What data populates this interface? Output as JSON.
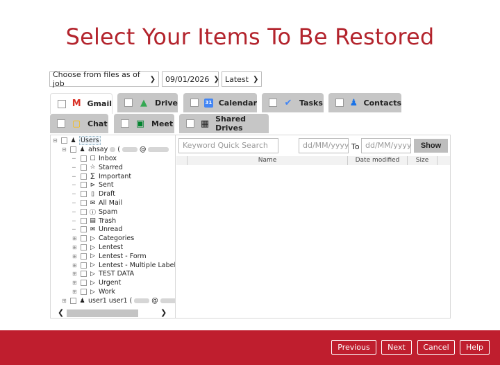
{
  "title": "Select Your Items To Be Restored",
  "filters": {
    "mode": "Choose from files as of job",
    "date": "09/01/2026",
    "version": "Latest"
  },
  "tabs": [
    {
      "label": "Gmail",
      "icon": "gmail-icon",
      "active": true
    },
    {
      "label": "Drive",
      "icon": "drive-icon"
    },
    {
      "label": "Calendar",
      "icon": "calendar-icon"
    },
    {
      "label": "Tasks",
      "icon": "tasks-icon"
    },
    {
      "label": "Contacts",
      "icon": "contacts-icon"
    },
    {
      "label": "Chat",
      "icon": "chat-icon"
    },
    {
      "label": "Meet",
      "icon": "meet-icon"
    },
    {
      "label": "Shared Drives",
      "icon": "shared-drives-icon"
    }
  ],
  "tree": {
    "root": "Users",
    "user1_name": "ahsay",
    "user1_paren": "(",
    "user1_at": "@",
    "folders": [
      {
        "label": "Inbox",
        "icon": "inbox-icon"
      },
      {
        "label": "Starred",
        "icon": "star-icon"
      },
      {
        "label": "Important",
        "icon": "important-icon"
      },
      {
        "label": "Sent",
        "icon": "sent-icon"
      },
      {
        "label": "Draft",
        "icon": "draft-icon"
      },
      {
        "label": "All Mail",
        "icon": "all-mail-icon"
      },
      {
        "label": "Spam",
        "icon": "spam-icon"
      },
      {
        "label": "Trash",
        "icon": "trash-icon"
      },
      {
        "label": "Unread",
        "icon": "unread-icon"
      }
    ],
    "labels": [
      "Categories",
      "Lentest",
      "Lentest - Form",
      "Lentest - Multiple Label",
      "TEST DATA",
      "Urgent",
      "Work"
    ],
    "user2_name": "user1 user1 (",
    "user2_at": "@"
  },
  "search": {
    "placeholder": "Keyword Quick Search",
    "from_placeholder": "dd/MM/yyyy",
    "to_label": "To",
    "to_placeholder": "dd/MM/yyyy",
    "show": "Show"
  },
  "columns": {
    "name": "Name",
    "date": "Date modified",
    "size": "Size"
  },
  "footer": {
    "previous": "Previous",
    "next": "Next",
    "cancel": "Cancel",
    "help": "Help"
  },
  "colors": {
    "brand": "#bf1e2e",
    "title": "#b3242d"
  }
}
